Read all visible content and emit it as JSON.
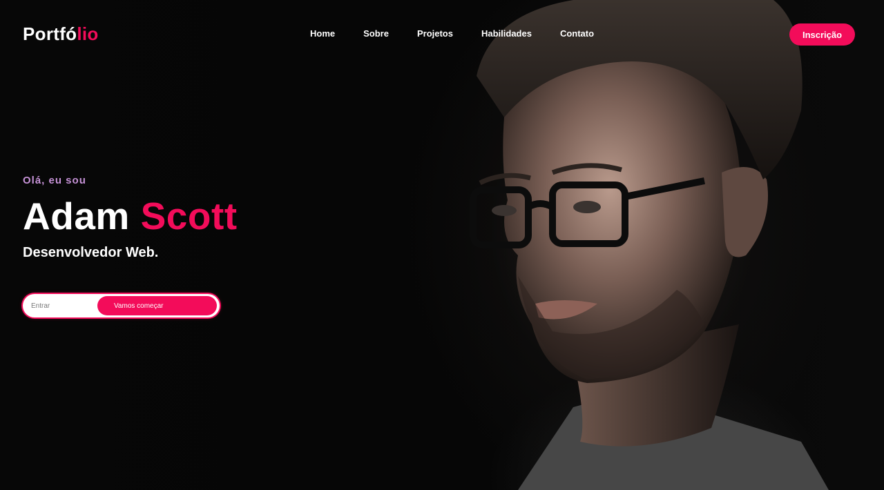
{
  "brand": {
    "logo_main": "Portfó",
    "logo_accent": "lio",
    "accent_color": "#f30c5a"
  },
  "nav": {
    "items": [
      {
        "label": "Home"
      },
      {
        "label": "Sobre"
      },
      {
        "label": "Projetos"
      },
      {
        "label": "Habilidades"
      },
      {
        "label": "Contato"
      }
    ]
  },
  "header": {
    "signup_label": "Inscrição"
  },
  "hero": {
    "greeting": "Olá, eu sou",
    "first_name": "Adam",
    "last_name": "Scott",
    "role": "Desenvolvedor Web.",
    "greeting_color": "#c793d8",
    "portrait_icon": "man-with-glasses-portrait"
  },
  "cta": {
    "input_placeholder": "Entrar",
    "button_label": "Vamos começar"
  }
}
